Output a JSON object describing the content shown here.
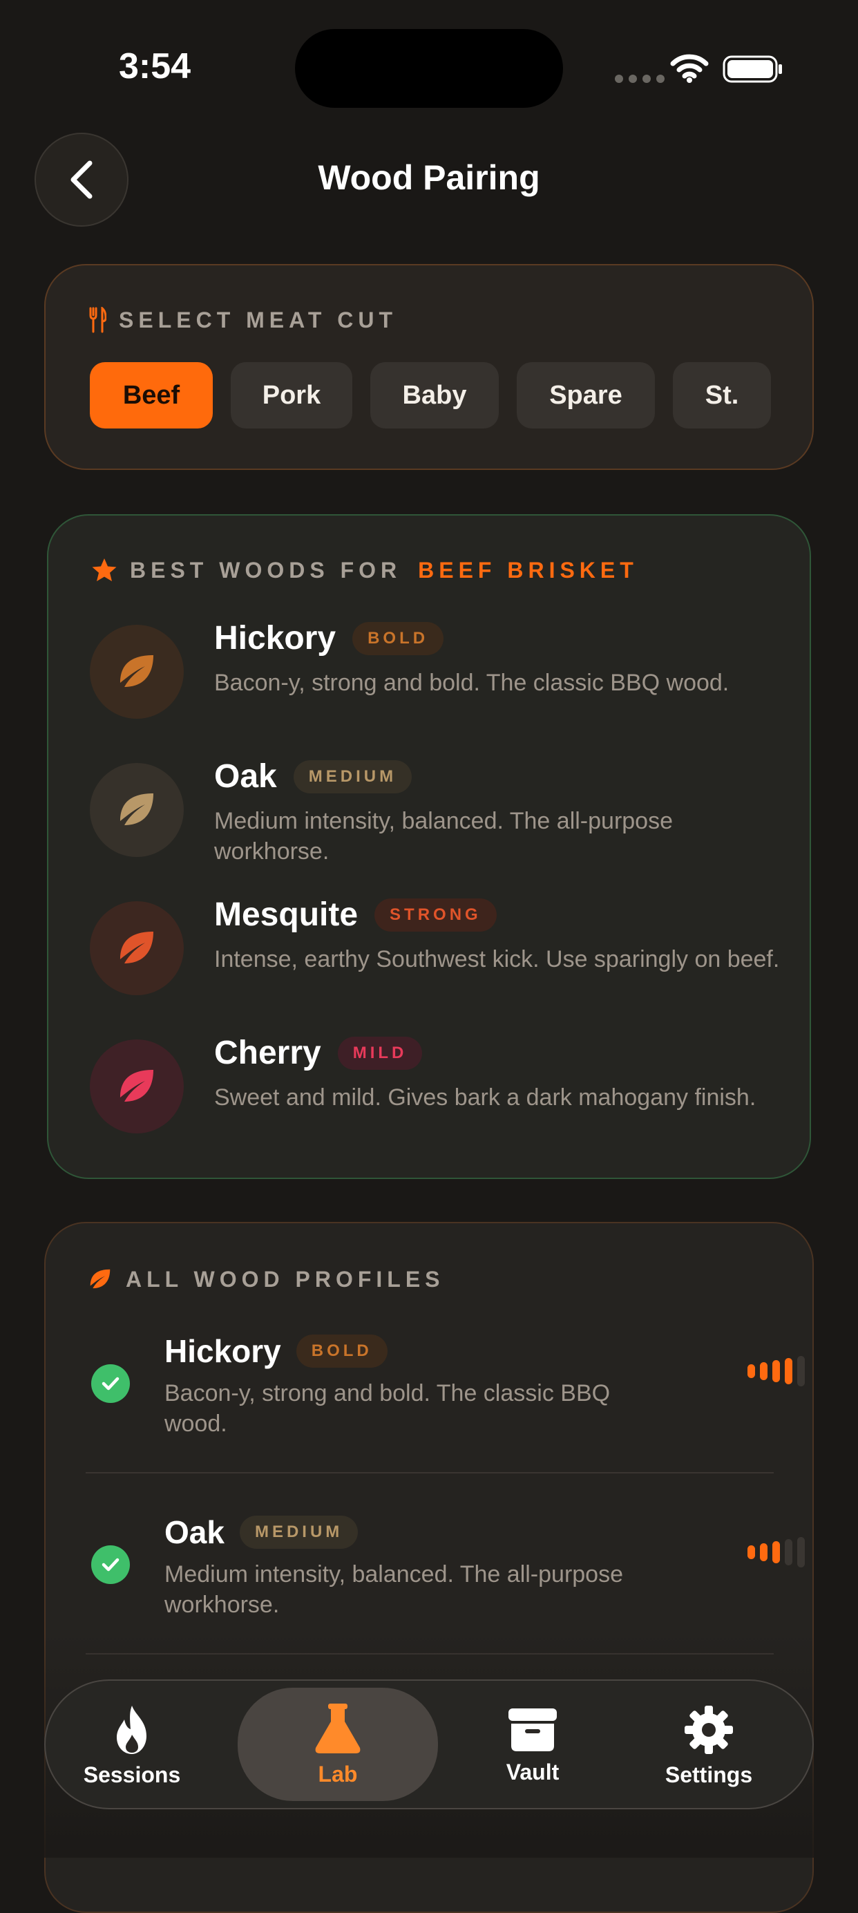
{
  "status_bar": {
    "time": "3:54"
  },
  "header": {
    "title": "Wood Pairing"
  },
  "meat_cut": {
    "heading": "SELECT MEAT CUT",
    "chips": [
      "Beef",
      "Pork",
      "Baby",
      "Spare",
      "St."
    ],
    "selected": "Beef"
  },
  "best_woods": {
    "heading_prefix": "BEST WOODS FOR",
    "heading_target": "BEEF BRISKET",
    "items": [
      {
        "name": "Hickory",
        "badge": "BOLD",
        "desc": "Bacon-y, strong and bold. The classic BBQ wood.",
        "color": "#c9742a"
      },
      {
        "name": "Oak",
        "badge": "MEDIUM",
        "desc": "Medium intensity, balanced. The all-purpose workhorse.",
        "color": "#b89868"
      },
      {
        "name": "Mesquite",
        "badge": "STRONG",
        "desc": "Intense, earthy Southwest kick. Use sparingly on beef.",
        "color": "#e0542a"
      },
      {
        "name": "Cherry",
        "badge": "MILD",
        "desc": "Sweet and mild. Gives bark a dark mahogany finish.",
        "color": "#e83a5a"
      }
    ]
  },
  "all_profiles": {
    "heading": "ALL WOOD PROFILES",
    "items": [
      {
        "name": "Hickory",
        "badge": "BOLD",
        "desc": "Bacon-y, strong and bold. The classic BBQ wood.",
        "intensity": 4,
        "max": 5
      },
      {
        "name": "Oak",
        "badge": "MEDIUM",
        "desc": "Medium intensity, balanced. The all-purpose workhorse.",
        "intensity": 3,
        "max": 5
      }
    ]
  },
  "tabbar": {
    "tabs": [
      {
        "label": "Sessions",
        "icon": "flame-icon"
      },
      {
        "label": "Lab",
        "icon": "flask-icon"
      },
      {
        "label": "Vault",
        "icon": "archive-icon"
      },
      {
        "label": "Settings",
        "icon": "gear-icon"
      }
    ],
    "active": "Lab"
  },
  "colors": {
    "accent": "#ff6a10",
    "check": "#3fbf6a",
    "background": "#1a1816"
  }
}
